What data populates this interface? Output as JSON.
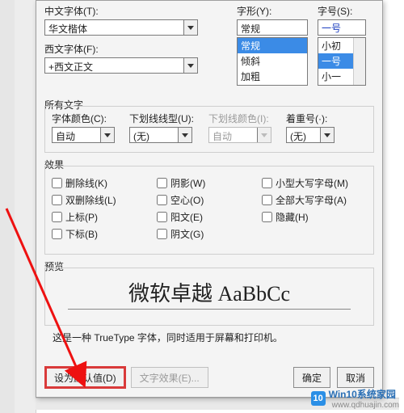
{
  "top": {
    "cn_label": "中文字体(T):",
    "cn_value": "华文楷体",
    "en_label": "西文字体(F):",
    "en_value": "+西文正文",
    "style_label": "字形(Y):",
    "style_value": "常规",
    "style_items": [
      "常规",
      "倾斜",
      "加粗"
    ],
    "size_label": "字号(S):",
    "size_value": "一号",
    "size_items": [
      "小初",
      "一号",
      "小一"
    ]
  },
  "allfont": {
    "group_label": "所有文字",
    "color_label": "字体颜色(C):",
    "color_value": "自动",
    "underline_label": "下划线线型(U):",
    "underline_value": "(无)",
    "ucolor_label": "下划线颜色(I):",
    "ucolor_value": "自动",
    "emphasis_label": "着重号(·):",
    "emphasis_value": "(无)"
  },
  "effects": {
    "group_label": "效果",
    "col1": [
      "删除线(K)",
      "双删除线(L)",
      "上标(P)",
      "下标(B)"
    ],
    "col2": [
      "阴影(W)",
      "空心(O)",
      "阳文(E)",
      "阴文(G)"
    ],
    "col3": [
      "小型大写字母(M)",
      "全部大写字母(A)",
      "隐藏(H)"
    ]
  },
  "preview": {
    "group_label": "预览",
    "sample": "微软卓越 AaBbCc",
    "note": "这是一种 TrueType 字体，同时适用于屏幕和打印机。"
  },
  "buttons": {
    "set_default": "设为默认值(D)",
    "text_effects": "文字效果(E)...",
    "ok": "确定",
    "cancel": "取消"
  },
  "watermark": {
    "title": "Win10系统家园",
    "url": "www.qdhuajin.com"
  }
}
